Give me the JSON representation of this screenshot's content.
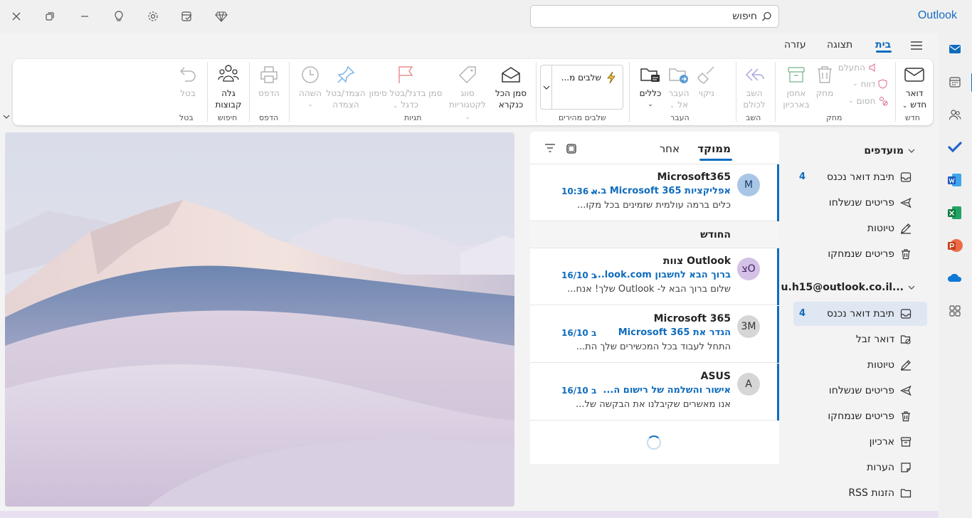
{
  "app": {
    "name": "Outlook"
  },
  "search": {
    "placeholder": "חיפוש"
  },
  "menu": {
    "tabs": [
      "בית",
      "תצוגה",
      "עזרה"
    ]
  },
  "ribbon": {
    "new": {
      "label1": "דואר",
      "label2": "חדש"
    },
    "delete_small": [
      "התעלם",
      "דווח",
      "חסום"
    ],
    "delete": "מחק",
    "archive": {
      "l1": "אחסן",
      "l2": "בארכיון"
    },
    "reply_all": {
      "l1": "השב",
      "l2": "לכולם"
    },
    "sweep": "ניקוי",
    "move": {
      "l1": "העבר",
      "l2": "אל"
    },
    "rules": "כללים",
    "quick_steps": "שלבים מ...",
    "mark_all_read": {
      "l1": "סמן הכל",
      "l2": "כנקרא"
    },
    "categorize": {
      "l1": "סווג",
      "l2": "לקטגוריות"
    },
    "flag": {
      "l1": "סמן בדגל/בטל סימון",
      "l2": "כדגל"
    },
    "pin": {
      "l1": "הצמד/בטל",
      "l2": "הצמדה"
    },
    "snooze": "השהה",
    "print": "הדפס",
    "discover_groups": {
      "l1": "גלה",
      "l2": "קבוצות"
    },
    "undo": "בטל",
    "groups": [
      "חדש",
      "מחק",
      "השב",
      "העבר",
      "שלבים מהירים",
      "תגיות",
      "הדפס",
      "חיפוש",
      "בטל"
    ]
  },
  "folders": {
    "favorites": {
      "title": "מועדפים",
      "items": [
        {
          "label": "תיבת דואר נכנס",
          "count": "4",
          "icon": "inbox-icon"
        },
        {
          "label": "פריטים שנשלחו",
          "count": "",
          "icon": "send-icon"
        },
        {
          "label": "טיוטות",
          "count": "",
          "icon": "pencil-icon"
        },
        {
          "label": "פריטים שנמחקו",
          "count": "",
          "icon": "trash-icon"
        }
      ]
    },
    "account": {
      "title": "u.h15@outlook.co.il...",
      "items": [
        {
          "label": "תיבת דואר נכנס",
          "count": "4",
          "icon": "inbox-icon"
        },
        {
          "label": "דואר זבל",
          "count": "",
          "icon": "junk-icon"
        },
        {
          "label": "טיוטות",
          "count": "",
          "icon": "pencil-icon"
        },
        {
          "label": "פריטים שנשלחו",
          "count": "",
          "icon": "send-icon"
        },
        {
          "label": "פריטים שנמחקו",
          "count": "",
          "icon": "trash-icon"
        },
        {
          "label": "ארכיון",
          "count": "",
          "icon": "archive-icon"
        },
        {
          "label": "הערות",
          "count": "",
          "icon": "note-icon"
        },
        {
          "label": "הזנות RSS",
          "count": "",
          "icon": "folder-icon"
        }
      ]
    }
  },
  "messages": {
    "tabs": {
      "focused": "ממוקד",
      "other": "אחר"
    },
    "section": "החודש",
    "items": [
      {
        "avatar": "M",
        "from": "Microsoft365",
        "subject": "אפליקציות Microsoft 365 ב...",
        "date": "א 10:36",
        "preview": "כלים ברמה עולמית שזמינים בכל מקו...",
        "avatar_bg": "#a9c6e6",
        "avatar_fg": "#1b3e6b"
      },
      {
        "avatar": "צO",
        "from": "צוות Outlook",
        "subject": "ברוך הבא לחשבון look.com...",
        "date": "ב 16/10",
        "preview": "שלום ברוך הבא ל- Outlook שלך! אנח...",
        "avatar_bg": "#d4c1e6",
        "avatar_fg": "#3e1f5c"
      },
      {
        "avatar": "3M",
        "from": "Microsoft 365",
        "subject": "הגדר את Microsoft 365",
        "date": "ב 16/10",
        "preview": "התחל לעבוד בכל המכשירים שלך הת...",
        "avatar_bg": "#d6d6d6",
        "avatar_fg": "#333333"
      },
      {
        "avatar": "A",
        "from": "ASUS",
        "subject": "אישור והשלמה של רישום ה...",
        "date": "ב 16/10",
        "preview": "אנו מאשרים שקיבלנו את הבקשה של...",
        "avatar_bg": "#d6d6d6",
        "avatar_fg": "#333333"
      }
    ]
  },
  "colors": {
    "accent": "#0f6cbd"
  }
}
